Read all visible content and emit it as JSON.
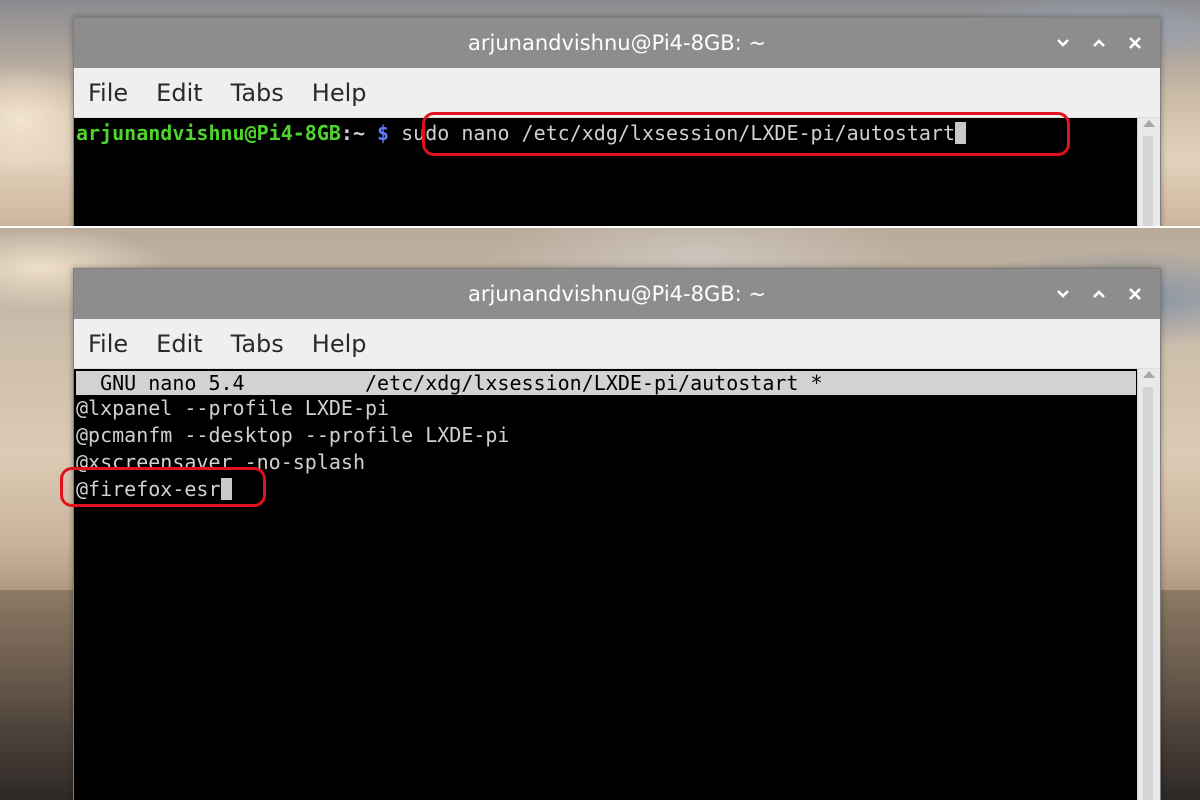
{
  "top": {
    "window_title": "arjunandvishnu@Pi4-8GB: ~",
    "menu": [
      "File",
      "Edit",
      "Tabs",
      "Help"
    ],
    "prompt_user": "arjunandvishnu@Pi4-8GB",
    "prompt_sep": ":~ ",
    "prompt_symbol": "$",
    "command": "sudo nano /etc/xdg/lxsession/LXDE-pi/autostart"
  },
  "bottom": {
    "window_title": "arjunandvishnu@Pi4-8GB: ~",
    "menu": [
      "File",
      "Edit",
      "Tabs",
      "Help"
    ],
    "nano_header": "  GNU nano 5.4          /etc/xdg/lxsession/LXDE-pi/autostart *",
    "lines": [
      "@lxpanel --profile LXDE-pi",
      "@pcmanfm --desktop --profile LXDE-pi",
      "@xscreensaver -no-splash",
      "@firefox-esr"
    ]
  },
  "icons": {
    "minimize": "chevron-down-icon",
    "maximize": "chevron-up-icon",
    "close": "close-icon"
  },
  "colors": {
    "titlebar": "#8d8d8d",
    "menubar": "#efefef",
    "terminal_bg": "#000000",
    "prompt_user": "#4fd42e",
    "prompt_path": "#5f7cff",
    "highlight": "#e0121b"
  }
}
